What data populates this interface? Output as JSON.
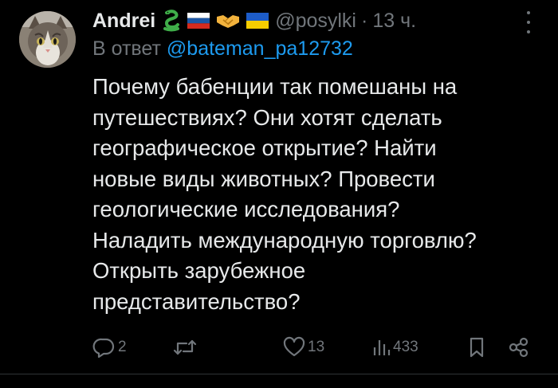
{
  "tweet": {
    "author": {
      "display_name": "Andrei",
      "handle": "@posylki",
      "badges": [
        "snake-emoji",
        "russia-flag-emoji",
        "handshake-emoji",
        "ukraine-flag-emoji"
      ],
      "avatar": "cat-avatar"
    },
    "separator": "·",
    "time": "13 ч.",
    "reply": {
      "prefix": "В ответ",
      "mention": "@bateman_pa12732"
    },
    "text": "Почему бабенции так помешаны на\nпутешествиях? Они хотят сделать\nгеографическое открытие? Найти\nновые виды животных? Провести\nгеологические исследования?\nНаладить международную торговлю?\nОткрыть зарубежное\nпредставительство?",
    "actions": {
      "replies": "2",
      "retweets": "",
      "likes": "13",
      "views": "433"
    }
  },
  "colors": {
    "background": "#000000",
    "text": "#e7e9ea",
    "secondary": "#71767b",
    "link": "#1d9bf0",
    "divider": "#2f3336"
  }
}
